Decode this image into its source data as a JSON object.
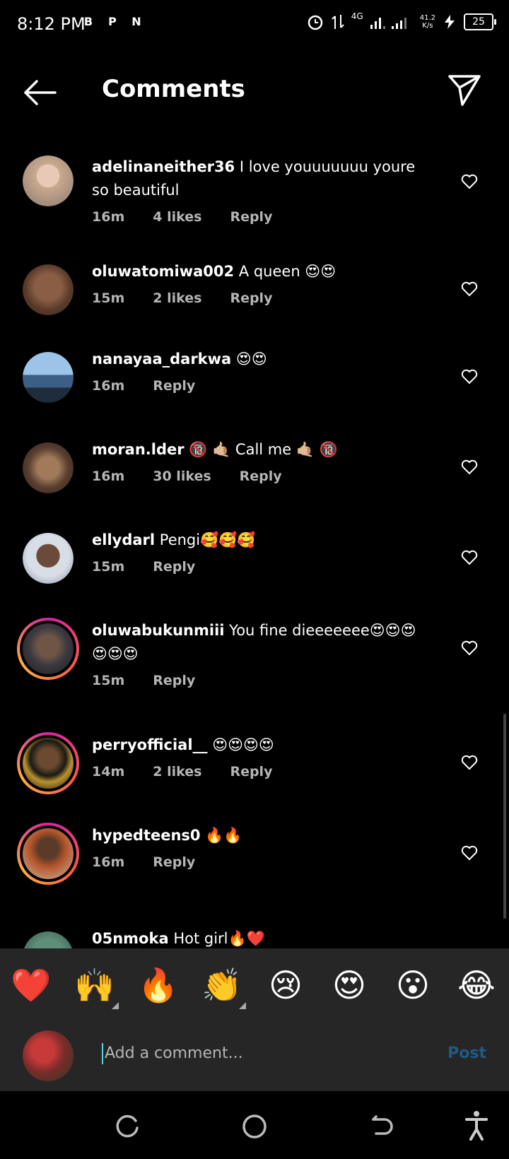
{
  "status_bar": {
    "time": "8:12 PM",
    "left_icons": [
      "B",
      "P",
      "N"
    ],
    "network": "4G",
    "net_speed_value": "41.2",
    "net_speed_unit": "K/s",
    "battery": "25"
  },
  "header": {
    "title": "Comments"
  },
  "comments": [
    {
      "username": "adelinaneither36",
      "text": "I love youuuuuuu youre so beautiful",
      "time": "16m",
      "likes": "4 likes",
      "reply": "Reply",
      "avatar_color": "#c9a98f",
      "ring": false
    },
    {
      "username": "oluwatomiwa002",
      "text": "A queen 😍😍",
      "time": "15m",
      "likes": "2 likes",
      "reply": "Reply",
      "avatar_color": "#6b4a3a",
      "ring": false
    },
    {
      "username": "nanayaa_darkwa",
      "text": "😍😍",
      "time": "16m",
      "likes": "",
      "reply": "Reply",
      "avatar_color": "#7fa5c8",
      "ring": false
    },
    {
      "username": "moran.lder",
      "text": "🔞 🤙🏼 Call me 🤙🏼 🔞",
      "time": "16m",
      "likes": "30 likes",
      "reply": "Reply",
      "avatar_color": "#5a4030",
      "ring": false
    },
    {
      "username": "ellydarl",
      "text": "Pengi🥰🥰🥰",
      "time": "15m",
      "likes": "",
      "reply": "Reply",
      "avatar_color": "#4a3b5c",
      "ring": false
    },
    {
      "username": "oluwabukunmiii",
      "text": "You fine dieeeeeee😍😍😍😍😍😍",
      "time": "15m",
      "likes": "",
      "reply": "Reply",
      "avatar_color": "#3c3a40",
      "ring": true
    },
    {
      "username": "perryofficial__",
      "text": "😍😍😍😍",
      "time": "14m",
      "likes": "2 likes",
      "reply": "Reply",
      "avatar_color": "#2b2416",
      "ring": true
    },
    {
      "username": "hypedteens0",
      "text": "🔥🔥",
      "time": "16m",
      "likes": "",
      "reply": "Reply",
      "avatar_color": "#b3542a",
      "ring": true
    },
    {
      "username": "05nmoka",
      "text": "Hot girl🔥❤️",
      "time": "",
      "likes": "",
      "reply": "",
      "avatar_color": "#5e8f7a",
      "ring": false
    }
  ],
  "reactions": [
    "❤️",
    "🙌",
    "🔥",
    "👏",
    "😢",
    "😍",
    "😮",
    "😂"
  ],
  "composer": {
    "placeholder": "Add a comment...",
    "post_label": "Post",
    "avatar_color": "#7a2b2b"
  },
  "icons": {
    "back": "arrow-left-icon",
    "send": "paper-plane-icon",
    "like": "heart-outline-icon",
    "nav_recent": "recent-apps-icon",
    "nav_home": "home-circle-icon",
    "nav_back": "back-icon",
    "accessibility": "accessibility-icon"
  }
}
